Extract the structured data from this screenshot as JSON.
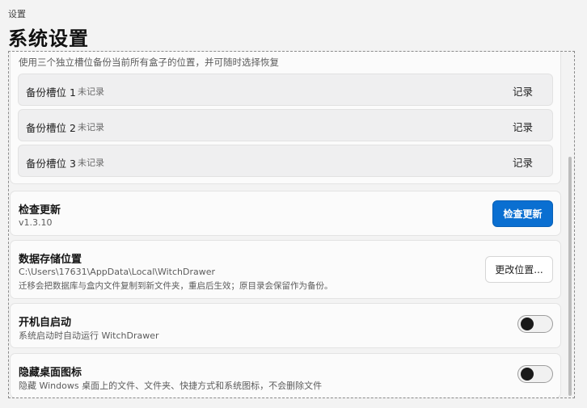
{
  "header": {
    "breadcrumb": "设置",
    "title": "系统设置"
  },
  "backup": {
    "description": "使用三个独立槽位备份当前所有盒子的位置，并可随时选择恢复",
    "slots": [
      {
        "name": "备份槽位 1",
        "status": "未记录",
        "action": "记录"
      },
      {
        "name": "备份槽位 2",
        "status": "未记录",
        "action": "记录"
      },
      {
        "name": "备份槽位 3",
        "status": "未记录",
        "action": "记录"
      }
    ]
  },
  "update": {
    "title": "检查更新",
    "version": "v1.3.10",
    "button": "检查更新"
  },
  "storage": {
    "title": "数据存储位置",
    "path": "C:\\Users\\17631\\AppData\\Local\\WitchDrawer",
    "note": "迁移会把数据库与盒内文件复制到新文件夹，重启后生效；原目录会保留作为备份。",
    "button": "更改位置..."
  },
  "autostart": {
    "title": "开机自启动",
    "description": "系统启动时自动运行 WitchDrawer",
    "enabled": false
  },
  "hide_icons": {
    "title": "隐藏桌面图标",
    "description": "隐藏 Windows 桌面上的文件、文件夹、快捷方式和系统图标，不会删除文件",
    "enabled": false
  },
  "colors": {
    "accent": "#0a6fd1",
    "background": "#f3f3f3",
    "card": "#fbfbfb"
  }
}
